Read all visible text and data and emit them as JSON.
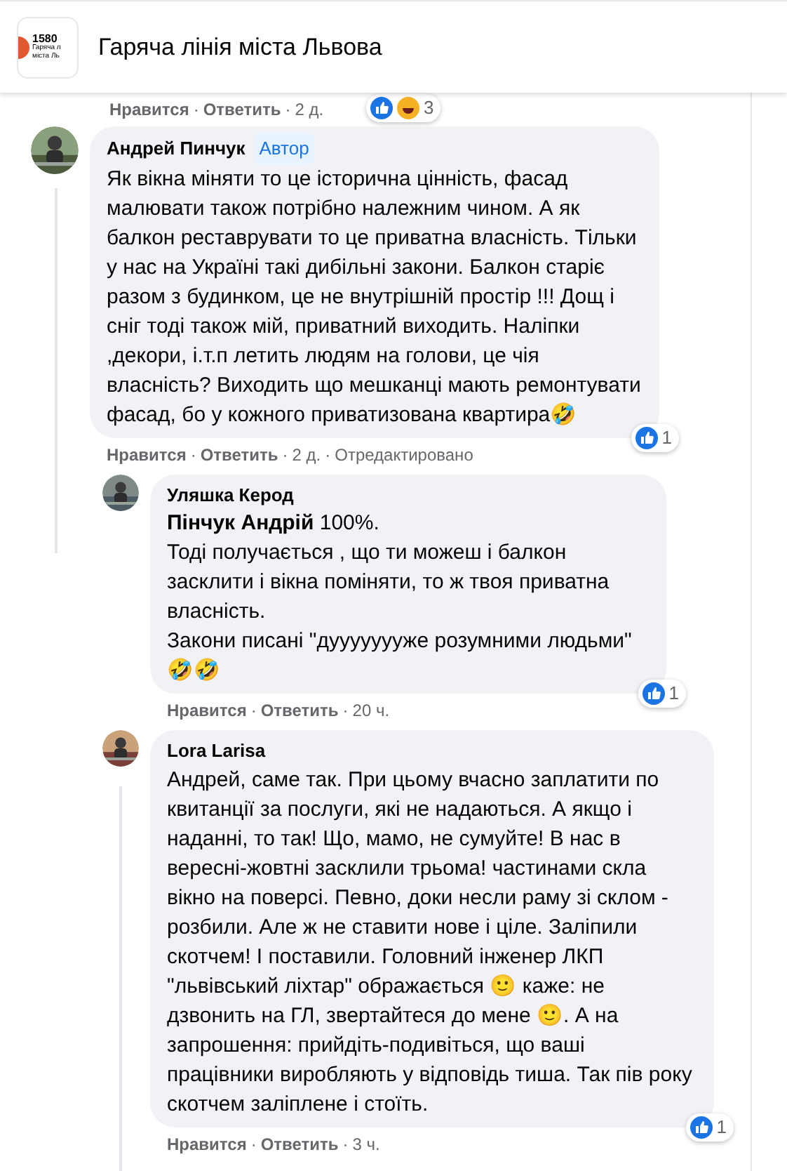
{
  "header": {
    "logo": {
      "number": "1580",
      "line1": "Гаряча л",
      "line2": "міста Ль"
    },
    "title": "Гаряча лінія міста Львова"
  },
  "previous_actions": {
    "like": "Нравится",
    "separator": "·",
    "reply": "Ответить",
    "time": "2 д.",
    "reaction_count": "3"
  },
  "comments": [
    {
      "author": "Андрей Пинчук",
      "author_badge": "Автор",
      "body": [
        "Як вікна міняти то це історична цінність, фасад малювати також потрібно належним чином. А як балкон реставрувати то це приватна власність. Тільки у нас на Україні такі дибільні закони. Балкон старіє разом з будинком, це не внутрішній простір !!! Дощ і сніг тоді також мій, приватний виходить. Наліпки ,декори, і.т.п летить людям на голови, це чія власність? Виходить що мешканці мають ремонтувати фасад, бо у кожного приватизована квартира🤣"
      ],
      "like": "Нравится",
      "separator": "·",
      "reply": "Ответить",
      "time": "2 д.",
      "edited": "Отредактировано",
      "reaction_count": "1",
      "replies": [
        {
          "author": "Уляшка Керод",
          "body": [
            "**Пінчук Андрій** 100%.",
            "Тоді получається , що ти можеш і балкон засклити і вікна поміняти, то ж твоя приватна власність.",
            "Закони писані \"дуууууууже розумними людьми\"",
            "🤣🤣"
          ],
          "like": "Нравится",
          "separator": "·",
          "reply": "Ответить",
          "time": "20 ч.",
          "reaction_count": "1"
        },
        {
          "author": "Lora Larisa",
          "body": [
            "Андрей, саме так. При цьому вчасно заплатити по квитанції за послуги, які не надаються. А якщо і наданні, то так! Що, мамо, не сумуйте! В нас в вересні-жовтні засклили трьома! частинами скла вікно на поверсі. Певно, доки несли раму зі склом - розбили. Але ж не ставити нове і ціле. Заліпили скотчем! І поставили. Головний інженер ЛКП \"львівський ліхтар\" ображається 🙂 каже: не дзвонить на ГЛ, звертайтеся до мене 🙂. А на запрошення: прийдіть-подивіться, що ваші працівники виробляють у відповідь тиша. Так пів року скотчем заліплене і стоїть."
          ],
          "like": "Нравится",
          "separator": "·",
          "reply": "Ответить",
          "time": "3 ч.",
          "reaction_count": "1"
        }
      ]
    }
  ]
}
